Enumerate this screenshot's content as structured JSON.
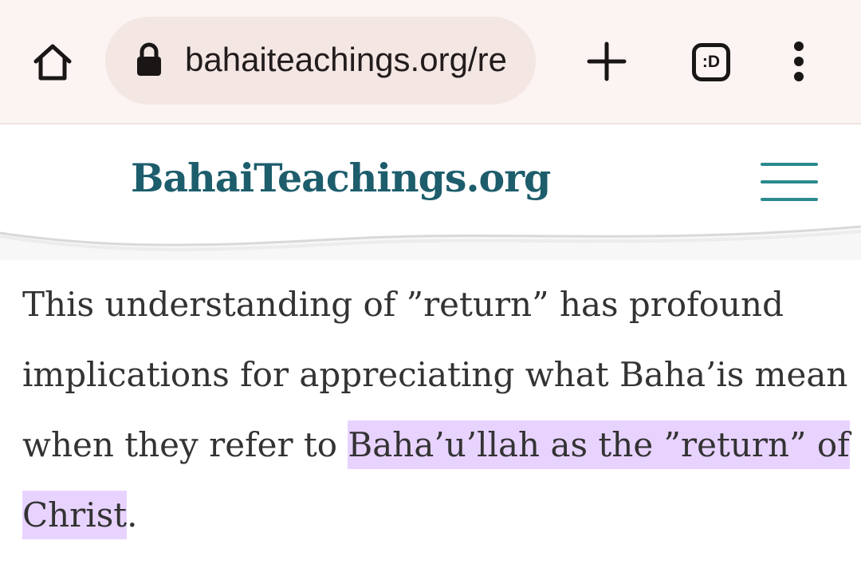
{
  "browser": {
    "url": "bahaiteachings.org/re",
    "tab_icon_label": ":D",
    "icons": [
      "home-icon",
      "lock-icon",
      "plus-icon",
      "tab-switcher-icon",
      "more-vert-icon"
    ]
  },
  "site": {
    "logo_text": "BahaiTeachings.org",
    "icons": [
      "logo-mark-icon",
      "hamburger-menu-icon"
    ],
    "colors": {
      "brand": "#1d5d6c",
      "menu": "#2a8a8e"
    }
  },
  "article": {
    "text_plain": "This understanding of ”return” has profound implications for appreciating what Baha’is mean when they refer to",
    "text_highlighted": "Baha’u’llah as the ”return” of Christ",
    "text_after": ".",
    "highlight_color": "#e8d3ff"
  }
}
